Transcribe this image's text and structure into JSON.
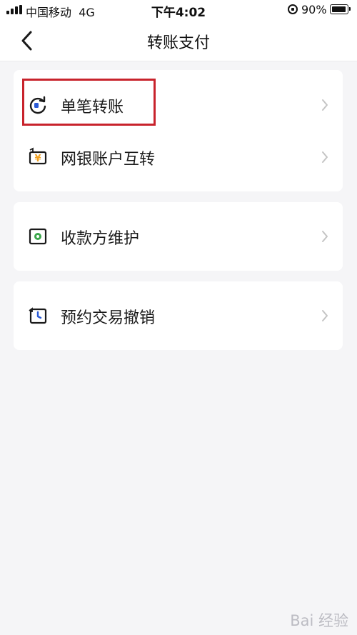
{
  "status_bar": {
    "carrier": "中国移动",
    "network": "4G",
    "time": "下午4:02",
    "battery": "90%"
  },
  "nav": {
    "title": "转账支付",
    "back_icon": "chevron-left-icon"
  },
  "menu_groups": [
    {
      "items": [
        {
          "label": "单笔转账",
          "icon": "refresh-transfer-icon",
          "highlighted": true
        },
        {
          "label": "网银账户互转",
          "icon": "currency-exchange-icon",
          "highlighted": false
        }
      ]
    },
    {
      "items": [
        {
          "label": "收款方维护",
          "icon": "payee-card-icon",
          "highlighted": false
        }
      ]
    },
    {
      "items": [
        {
          "label": "预约交易撤销",
          "icon": "scheduled-cancel-icon",
          "highlighted": false
        }
      ]
    }
  ],
  "watermark": "Bai 经验",
  "colors": {
    "highlight": "#c8232c",
    "accent_blue": "#2b5bd7",
    "accent_orange": "#f0a020",
    "accent_green": "#3aa64a",
    "background": "#f5f5f7"
  }
}
